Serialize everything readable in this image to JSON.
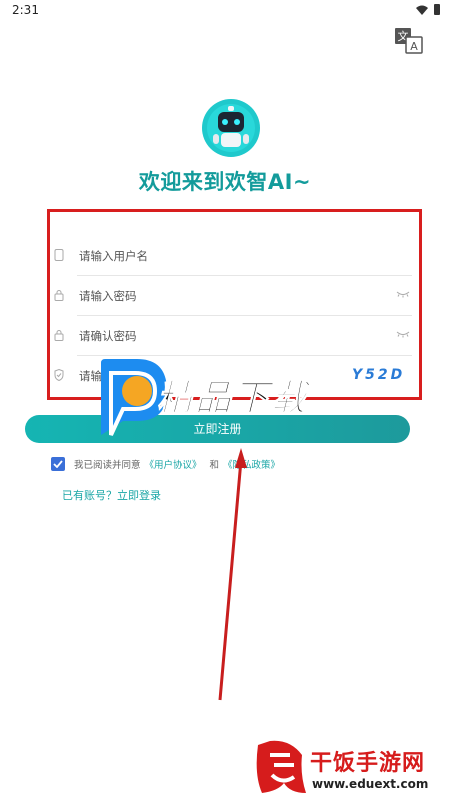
{
  "status_bar": {
    "time": "2:31"
  },
  "header": {
    "welcome": "欢迎来到欢智AI~"
  },
  "form": {
    "username_placeholder": "请输入用户名",
    "password_placeholder": "请输入密码",
    "confirm_password_placeholder": "请确认密码",
    "captcha_placeholder": "请输入验证码",
    "captcha_text": "Y52D"
  },
  "register_button": "立即注册",
  "agreement": {
    "prefix": "我已阅读并同意",
    "user_agreement": "《用户协议》",
    "and": "和",
    "privacy_policy": "《隐私政策》"
  },
  "login_link": "已有账号？立即登录",
  "watermarks": {
    "top_text": "精品下载",
    "bottom_title": "干饭手游网",
    "bottom_url": "www.eduext.com"
  },
  "colors": {
    "accent": "#1aa6a6",
    "highlight_box": "#d81e1e"
  }
}
